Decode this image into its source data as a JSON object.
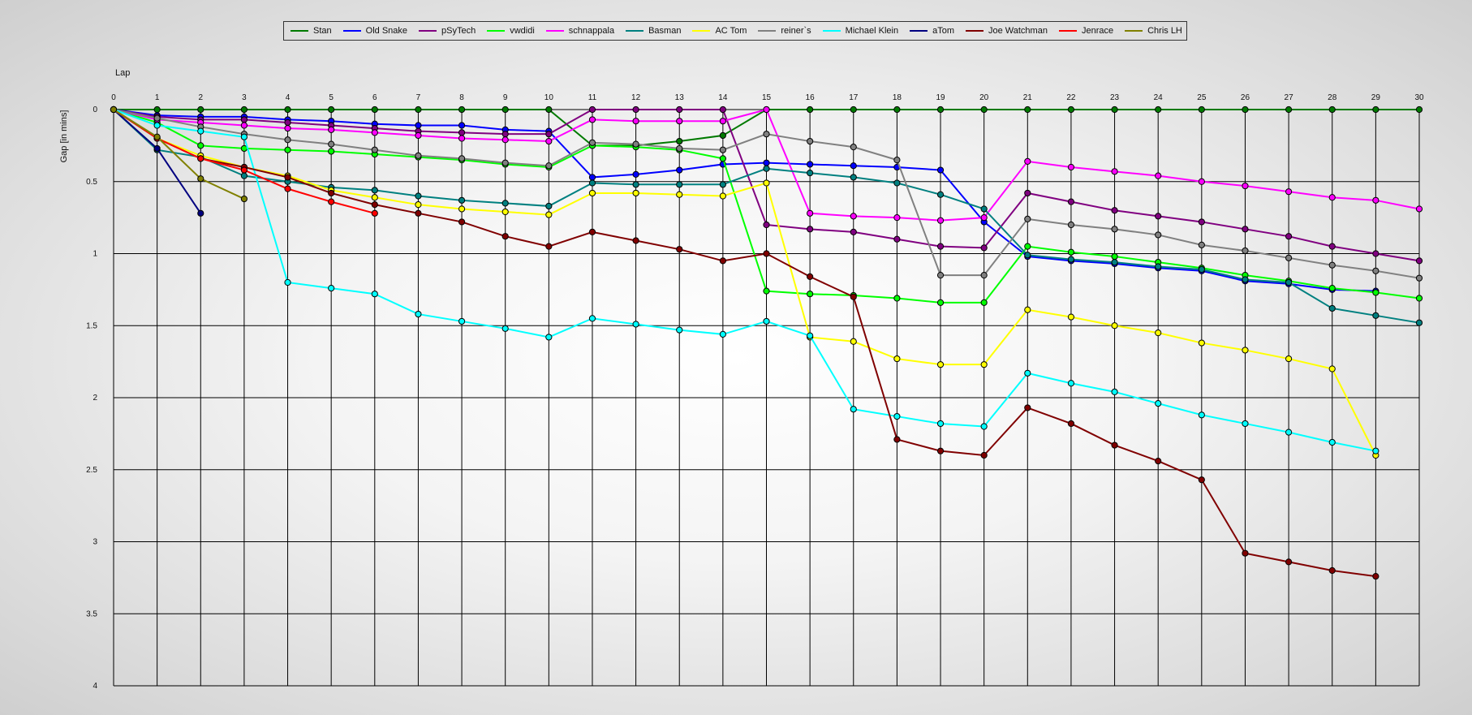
{
  "chart_data": {
    "type": "line",
    "xlabel": "Lap",
    "ylabel": "Gap [in mins]",
    "xlim": [
      0,
      30
    ],
    "ylim": [
      0,
      4
    ],
    "y_inverted": true,
    "x_ticks": [
      "0",
      "1",
      "2",
      "3",
      "4",
      "5",
      "6",
      "7",
      "8",
      "9",
      "10",
      "11",
      "12",
      "13",
      "14",
      "15",
      "16",
      "17",
      "18",
      "19",
      "20",
      "21",
      "22",
      "23",
      "24",
      "25",
      "26",
      "27",
      "28",
      "29",
      "30"
    ],
    "y_ticks": [
      "0",
      "0.5",
      "1",
      "1.5",
      "2",
      "2.5",
      "3",
      "3.5",
      "4"
    ],
    "grid": true,
    "legend_position": "top",
    "series": [
      {
        "name": "Stan",
        "color": "#007a00",
        "x": [
          0,
          1,
          2,
          3,
          4,
          5,
          6,
          7,
          8,
          9,
          10,
          11,
          12,
          13,
          14,
          15,
          16,
          17,
          18,
          19,
          20,
          21,
          22,
          23,
          24,
          25,
          26,
          27,
          28,
          29,
          30
        ],
        "values": [
          0,
          0,
          0,
          0,
          0,
          0,
          0,
          0,
          0,
          0,
          0,
          0.25,
          0.25,
          0.22,
          0.18,
          0,
          0,
          0,
          0,
          0,
          0,
          0,
          0,
          0,
          0,
          0,
          0,
          0,
          0,
          0,
          0
        ]
      },
      {
        "name": "Old Snake",
        "color": "#0000ff",
        "x": [
          0,
          1,
          2,
          3,
          4,
          5,
          6,
          7,
          8,
          9,
          10,
          11,
          12,
          13,
          14,
          15,
          16,
          17,
          18,
          19,
          20,
          21,
          22,
          23,
          24,
          25,
          26,
          27,
          28,
          29
        ],
        "values": [
          0,
          0.04,
          0.05,
          0.05,
          0.07,
          0.08,
          0.1,
          0.11,
          0.11,
          0.14,
          0.15,
          0.47,
          0.45,
          0.42,
          0.38,
          0.37,
          0.38,
          0.39,
          0.4,
          0.42,
          0.78,
          1.02,
          1.05,
          1.07,
          1.1,
          1.12,
          1.19,
          1.21,
          1.25,
          1.26
        ]
      },
      {
        "name": "pSyTech",
        "color": "#800080",
        "x": [
          0,
          1,
          2,
          3,
          4,
          5,
          6,
          7,
          8,
          9,
          10,
          11,
          12,
          13,
          14,
          15,
          16,
          17,
          18,
          19,
          20,
          21,
          22,
          23,
          24,
          25,
          26,
          27,
          28,
          29,
          30
        ],
        "values": [
          0,
          0.05,
          0.07,
          0.07,
          0.09,
          0.11,
          0.13,
          0.15,
          0.16,
          0.17,
          0.17,
          0,
          0,
          0,
          0,
          0.8,
          0.83,
          0.85,
          0.9,
          0.95,
          0.96,
          0.58,
          0.64,
          0.7,
          0.74,
          0.78,
          0.83,
          0.88,
          0.95,
          1.0,
          1.05
        ]
      },
      {
        "name": "vwdidi",
        "color": "#00ff00",
        "x": [
          0,
          1,
          2,
          3,
          4,
          5,
          6,
          7,
          8,
          9,
          10,
          11,
          12,
          13,
          14,
          15,
          16,
          17,
          18,
          19,
          20,
          21,
          22,
          23,
          24,
          25,
          26,
          27,
          28,
          29,
          30
        ],
        "values": [
          0,
          0.09,
          0.25,
          0.27,
          0.28,
          0.29,
          0.31,
          0.33,
          0.35,
          0.38,
          0.4,
          0.25,
          0.26,
          0.28,
          0.34,
          1.26,
          1.28,
          1.29,
          1.31,
          1.34,
          1.34,
          0.95,
          0.99,
          1.02,
          1.06,
          1.1,
          1.15,
          1.19,
          1.24,
          1.27,
          1.31
        ]
      },
      {
        "name": "schnappala",
        "color": "#ff00ff",
        "x": [
          0,
          1,
          2,
          3,
          4,
          5,
          6,
          7,
          8,
          9,
          10,
          11,
          12,
          13,
          14,
          15,
          16,
          17,
          18,
          19,
          20,
          21,
          22,
          23,
          24,
          25,
          26,
          27,
          28,
          29,
          30
        ],
        "values": [
          0,
          0.07,
          0.09,
          0.11,
          0.13,
          0.14,
          0.16,
          0.18,
          0.2,
          0.21,
          0.22,
          0.07,
          0.08,
          0.08,
          0.08,
          0,
          0.72,
          0.74,
          0.75,
          0.77,
          0.75,
          0.36,
          0.4,
          0.43,
          0.46,
          0.5,
          0.53,
          0.57,
          0.61,
          0.63,
          0.69
        ]
      },
      {
        "name": "Basman",
        "color": "#008080",
        "x": [
          0,
          1,
          2,
          3,
          4,
          5,
          6,
          7,
          8,
          9,
          10,
          11,
          12,
          13,
          14,
          15,
          16,
          17,
          18,
          19,
          20,
          21,
          22,
          23,
          24,
          25,
          26,
          27,
          28,
          29,
          30
        ],
        "values": [
          0,
          0.28,
          0.33,
          0.46,
          0.5,
          0.54,
          0.56,
          0.6,
          0.63,
          0.65,
          0.67,
          0.51,
          0.52,
          0.52,
          0.52,
          0.41,
          0.44,
          0.47,
          0.51,
          0.59,
          0.69,
          1.01,
          1.04,
          1.06,
          1.09,
          1.11,
          1.18,
          1.2,
          1.38,
          1.43,
          1.48
        ]
      },
      {
        "name": "AC Tom",
        "color": "#ffff00",
        "x": [
          0,
          1,
          2,
          3,
          4,
          5,
          6,
          7,
          8,
          9,
          10,
          11,
          12,
          13,
          14,
          15,
          16,
          17,
          18,
          19,
          20,
          21,
          22,
          23,
          24,
          25,
          26,
          27,
          28,
          29
        ],
        "values": [
          0,
          0.2,
          0.32,
          0.4,
          0.46,
          0.56,
          0.61,
          0.66,
          0.69,
          0.71,
          0.73,
          0.58,
          0.58,
          0.59,
          0.6,
          0.51,
          1.58,
          1.61,
          1.73,
          1.77,
          1.77,
          1.39,
          1.44,
          1.5,
          1.55,
          1.62,
          1.67,
          1.73,
          1.8,
          2.4
        ]
      },
      {
        "name": "reiner`s",
        "color": "#808080",
        "x": [
          0,
          1,
          2,
          3,
          4,
          5,
          6,
          7,
          8,
          9,
          10,
          11,
          12,
          13,
          14,
          15,
          16,
          17,
          18,
          19,
          20,
          21,
          22,
          23,
          24,
          25,
          26,
          27,
          28,
          29,
          30
        ],
        "values": [
          0,
          0.06,
          0.12,
          0.17,
          0.21,
          0.24,
          0.28,
          0.32,
          0.34,
          0.37,
          0.39,
          0.23,
          0.24,
          0.27,
          0.28,
          0.17,
          0.22,
          0.26,
          0.35,
          1.15,
          1.15,
          0.76,
          0.8,
          0.83,
          0.87,
          0.94,
          0.98,
          1.03,
          1.08,
          1.12,
          1.17
        ]
      },
      {
        "name": "Michael Klein",
        "color": "#00ffff",
        "x": [
          0,
          1,
          2,
          3,
          4,
          5,
          6,
          7,
          8,
          9,
          10,
          11,
          12,
          13,
          14,
          15,
          16,
          17,
          18,
          19,
          20,
          21,
          22,
          23,
          24,
          25,
          26,
          27,
          28,
          29
        ],
        "values": [
          0,
          0.11,
          0.15,
          0.19,
          1.2,
          1.24,
          1.28,
          1.42,
          1.47,
          1.52,
          1.58,
          1.45,
          1.49,
          1.53,
          1.56,
          1.47,
          1.57,
          2.08,
          2.13,
          2.18,
          2.2,
          1.83,
          1.9,
          1.96,
          2.04,
          2.12,
          2.18,
          2.24,
          2.31,
          2.37
        ]
      },
      {
        "name": "aTom",
        "color": "#000080",
        "x": [
          0,
          1,
          2
        ],
        "values": [
          0,
          0.27,
          0.72
        ]
      },
      {
        "name": "Joe Watchman",
        "color": "#800000",
        "x": [
          0,
          1,
          2,
          3,
          4,
          5,
          6,
          7,
          8,
          9,
          10,
          11,
          12,
          13,
          14,
          15,
          16,
          17,
          18,
          19,
          20,
          21,
          22,
          23,
          24,
          25,
          26,
          27,
          28,
          29
        ],
        "values": [
          0,
          0.2,
          0.34,
          0.4,
          0.47,
          0.58,
          0.66,
          0.72,
          0.78,
          0.88,
          0.95,
          0.85,
          0.91,
          0.97,
          1.05,
          1.0,
          1.16,
          1.3,
          2.29,
          2.37,
          2.4,
          2.07,
          2.18,
          2.33,
          2.44,
          2.57,
          3.08,
          3.14,
          3.2,
          3.24
        ]
      },
      {
        "name": "Jenrace",
        "color": "#ff0000",
        "x": [
          0,
          1,
          2,
          3,
          4,
          5,
          6
        ],
        "values": [
          0,
          0.2,
          0.34,
          0.42,
          0.55,
          0.64,
          0.72
        ]
      },
      {
        "name": "Chris LH",
        "color": "#808000",
        "x": [
          0,
          1,
          2,
          3
        ],
        "values": [
          0,
          0.19,
          0.48,
          0.62
        ]
      }
    ]
  }
}
